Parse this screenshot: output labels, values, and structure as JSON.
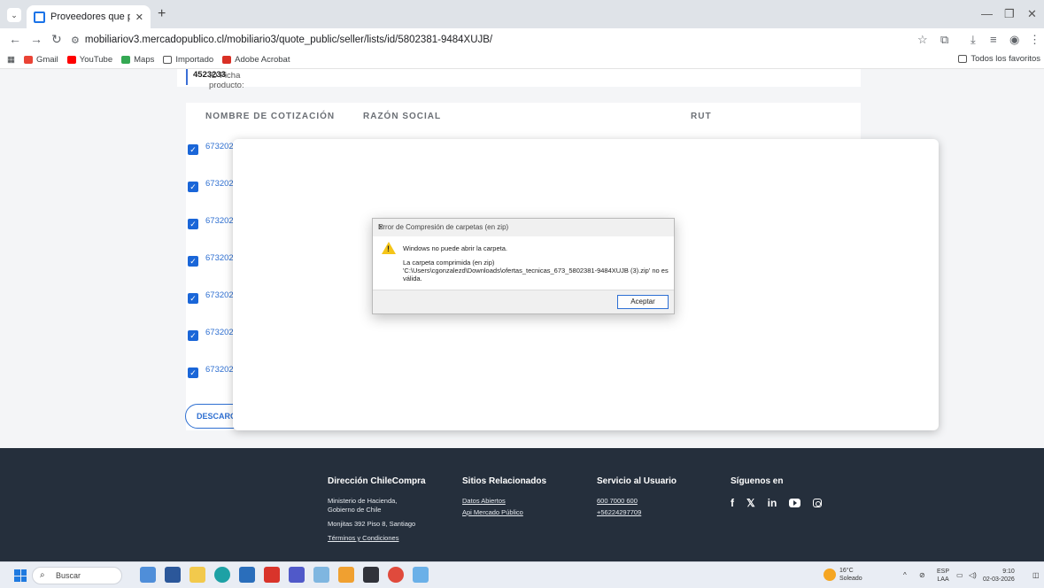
{
  "browser": {
    "tab_title": "Proveedores que participaron e",
    "url": "mobiliariov3.mercadopublico.cl/mobiliario3/quote_public/seller/lists/id/5802381-9484XUJB/",
    "bookmarks": [
      "Gmail",
      "YouTube",
      "Maps",
      "Importado",
      "Adobe Acrobat"
    ],
    "all_bookmarks": "Todos los favoritos"
  },
  "page": {
    "product_id_label": "ID Ficha producto:",
    "product_id_value": "4523233",
    "columns": [
      "NOMBRE DE COTIZACIÓN",
      "RAZÓN SOCIAL",
      "RUT"
    ],
    "rows": [
      {
        "name": "6732026"
      },
      {
        "name": "6732026"
      },
      {
        "name": "6732026"
      },
      {
        "name": "6732026"
      },
      {
        "name": "6732026"
      },
      {
        "name": "6732026"
      },
      {
        "name": "6732026"
      }
    ],
    "download_button": "DESCARGA"
  },
  "dialog": {
    "title": "Error de Compresión de carpetas (en zip)",
    "message": "Windows no puede abrir la carpeta.",
    "detail": "La carpeta comprimida (en zip) 'C:\\Users\\cgonzalezd\\Downloads\\ofertas_tecnicas_673_5802381-9484XUJB (3).zip' no es válida.",
    "ok_button": "Aceptar"
  },
  "footer": {
    "col1": {
      "title": "Dirección ChileCompra",
      "line1": "Ministerio de Hacienda,",
      "line2": "Gobierno de Chile",
      "address": "Monjitas 392 Piso 8, Santiago",
      "terms": "Términos y Condiciones"
    },
    "col2": {
      "title": "Sitios Relacionados",
      "link1": "Datos Abiertos",
      "link2": "Api Mercado Público"
    },
    "col3": {
      "title": "Servicio al Usuario",
      "phone1": "600 7000 600",
      "phone2": "+56224297709"
    },
    "col4": {
      "title": "Síguenos en",
      "facebook": "f",
      "twitter": "𝕏",
      "linkedin": "in"
    }
  },
  "taskbar": {
    "search_placeholder": "Buscar",
    "temperature": "16°C",
    "weather": "Soleado",
    "lang1": "ESP",
    "lang2": "LAA",
    "time": "9:10",
    "date": "02-03-2026"
  }
}
